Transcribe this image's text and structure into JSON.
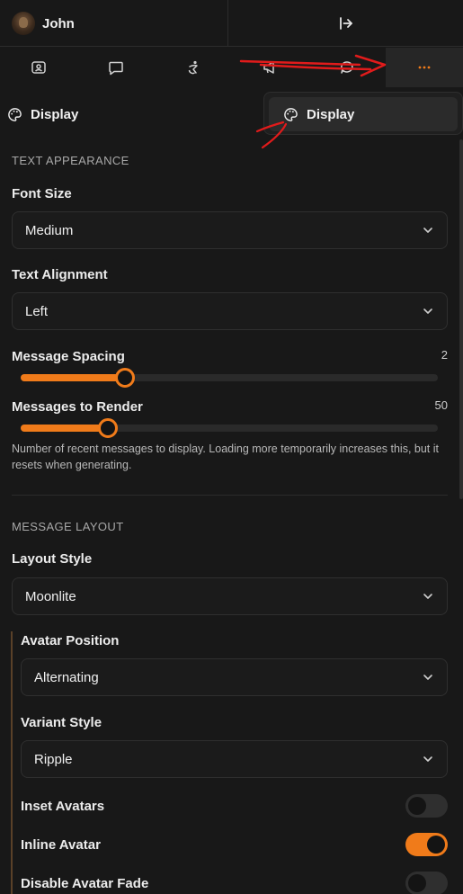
{
  "user": {
    "name": "John"
  },
  "accent_color": "#f07b1a",
  "tabs": [
    {
      "icon": "id-card-icon",
      "active": false
    },
    {
      "icon": "chat-bubble-icon",
      "active": false
    },
    {
      "icon": "accessibility-icon",
      "active": false
    },
    {
      "icon": "megaphone-icon",
      "active": false
    },
    {
      "icon": "speech-bubble-icon",
      "active": false
    },
    {
      "icon": "ellipsis-icon",
      "active": true
    }
  ],
  "menu_popup": {
    "item_label": "Display"
  },
  "header": {
    "title": "Display"
  },
  "text_appearance": {
    "title": "TEXT APPEARANCE",
    "font_size": {
      "label": "Font Size",
      "value": "Medium"
    },
    "text_alignment": {
      "label": "Text Alignment",
      "value": "Left"
    },
    "message_spacing": {
      "label": "Message Spacing",
      "value": "2",
      "fraction": 0.25
    },
    "messages_to_render": {
      "label": "Messages to Render",
      "value": "50",
      "fraction": 0.21,
      "help": "Number of recent messages to display. Loading more temporarily increases this, but it resets when generating."
    }
  },
  "message_layout": {
    "title": "MESSAGE LAYOUT",
    "layout_style": {
      "label": "Layout Style",
      "value": "Moonlite"
    },
    "avatar_position": {
      "label": "Avatar Position",
      "value": "Alternating"
    },
    "variant_style": {
      "label": "Variant Style",
      "value": "Ripple"
    },
    "inset_avatars": {
      "label": "Inset Avatars",
      "on": false
    },
    "inline_avatar": {
      "label": "Inline Avatar",
      "on": true
    },
    "disable_avatar_fade": {
      "label": "Disable Avatar Fade",
      "on": false
    }
  }
}
